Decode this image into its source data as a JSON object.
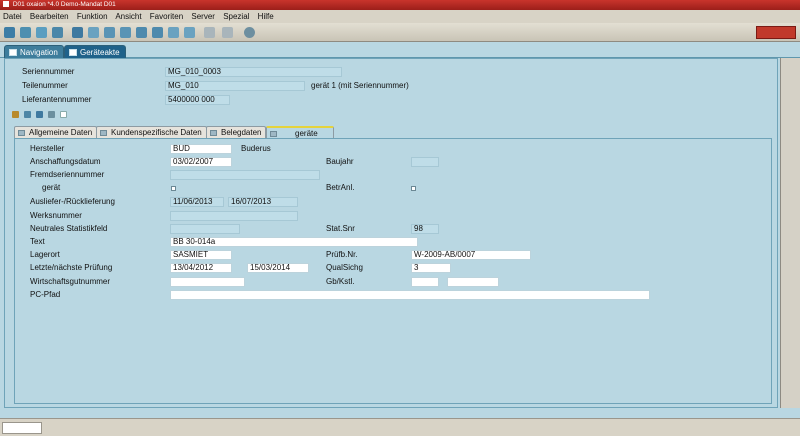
{
  "window": {
    "title": "D01 oxaion *4.0 Demo-Mandat D01"
  },
  "menu": [
    "Datei",
    "Bearbeiten",
    "Funktion",
    "Ansicht",
    "Favoriten",
    "Server",
    "Spezial",
    "Hilfe"
  ],
  "nav_tabs": [
    "Navigation",
    "Geräteakte"
  ],
  "header": {
    "seriennummer_label": "Seriennummer",
    "seriennummer": "MG_010_0003",
    "teilenummer_label": "Teilenummer",
    "teilenummer": "MG_010",
    "teil_desc": "gerät 1 (mit Seriennummer)",
    "lieferant_label": "Lieferantennummer",
    "lieferant": "5400000 000"
  },
  "tabs": [
    "Allgemeine Daten",
    "Kundenspezifische Daten",
    "Belegdaten",
    "geräte"
  ],
  "form": {
    "hersteller_label": "Hersteller",
    "hersteller": "BUD",
    "hersteller_name": "Buderus",
    "anschaffung_label": "Anschaffungsdatum",
    "anschaffung": "03/02/2007",
    "baujahr_label": "Baujahr",
    "fremdserien_label": "Fremdseriennummer",
    "geraet_label": "gerät",
    "betranl_label": "BetrAnl.",
    "ausliefer_label": "Auslief­er-/Rücklieferung",
    "ausliefer1": "11/06/2013",
    "ausliefer2": "16/07/2013",
    "werks_label": "Werksnummer",
    "statistik_label": "Neutrales Statistikfeld",
    "statsnr_label": "Stat.Snr",
    "statsnr": "98",
    "text_label": "Text",
    "text": "BB 30-014a",
    "lagerort_label": "Lagerort",
    "lagerort": "SASMIET",
    "pruefnr_label": "Prüfb.Nr.",
    "pruefnr": "W-2009-AB/0007",
    "pruefung_label": "Letzte/nächste Prüfung",
    "pruefung1": "13/04/2012",
    "pruefung2": "15/03/2014",
    "qualsichg_label": "QualSichg",
    "qualsichg": "3",
    "wirtschaft_label": "Wirtschaftsgutnummer",
    "gbkstl_label": "Gb/Kstl.",
    "pcpfad_label": "PC-Pfad"
  }
}
